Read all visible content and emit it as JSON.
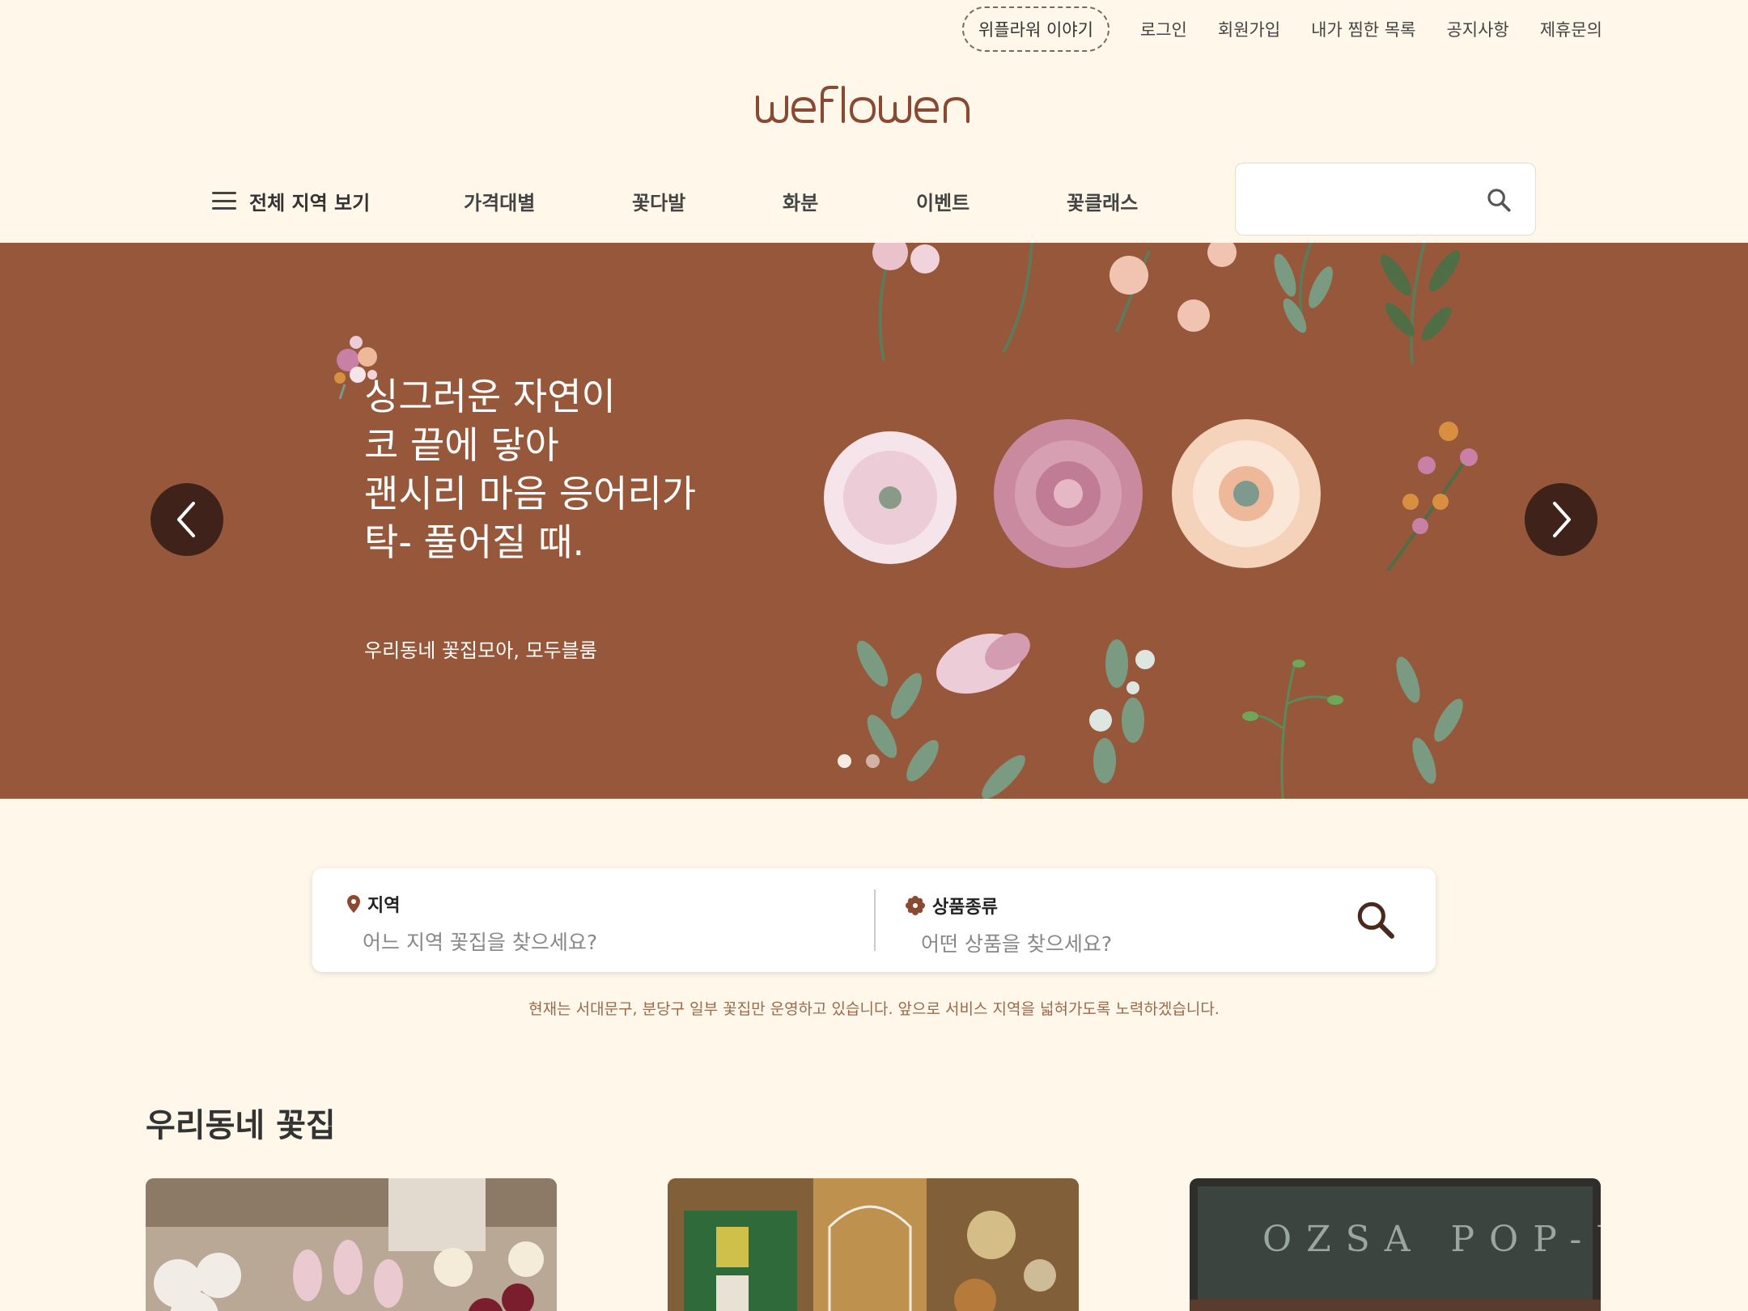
{
  "topnav": {
    "story": "위플라워 이야기",
    "links": [
      "로그인",
      "회원가입",
      "내가 찜한 목록",
      "공지사항",
      "제휴문의"
    ]
  },
  "logo": {
    "text": "weflower"
  },
  "mainnav": {
    "all_region": "전체 지역 보기",
    "items": [
      "가격대별",
      "꽃다발",
      "화분",
      "이벤트",
      "꽃클래스"
    ]
  },
  "search": {
    "value": ""
  },
  "hero": {
    "headline": "싱그러운 자연이\n코 끝에 닿아\n괜시리 마음 응어리가\n탁- 풀어질 때.",
    "sub": "우리동네 꽃집모아, 모두블룸",
    "background": "#97573a",
    "slide_count": 2,
    "active_slide": 1
  },
  "finder": {
    "region_label": "지역",
    "region_placeholder": "어느 지역 꽃집을 찾으세요?",
    "product_label": "상품종류",
    "product_placeholder": "어떤 상품을 찾으세요?"
  },
  "notice": "현재는 서대문구, 분당구 일부 꽃집만 운영하고 있습니다. 앞으로 서비스 지역을 넓혀가도록 노력하겠습니다.",
  "section": {
    "title": "우리동네 꽃집"
  },
  "colors": {
    "background": "#fef7ea",
    "hero": "#97573a",
    "arrow": "#3f231a",
    "accent": "#8a4a32"
  }
}
